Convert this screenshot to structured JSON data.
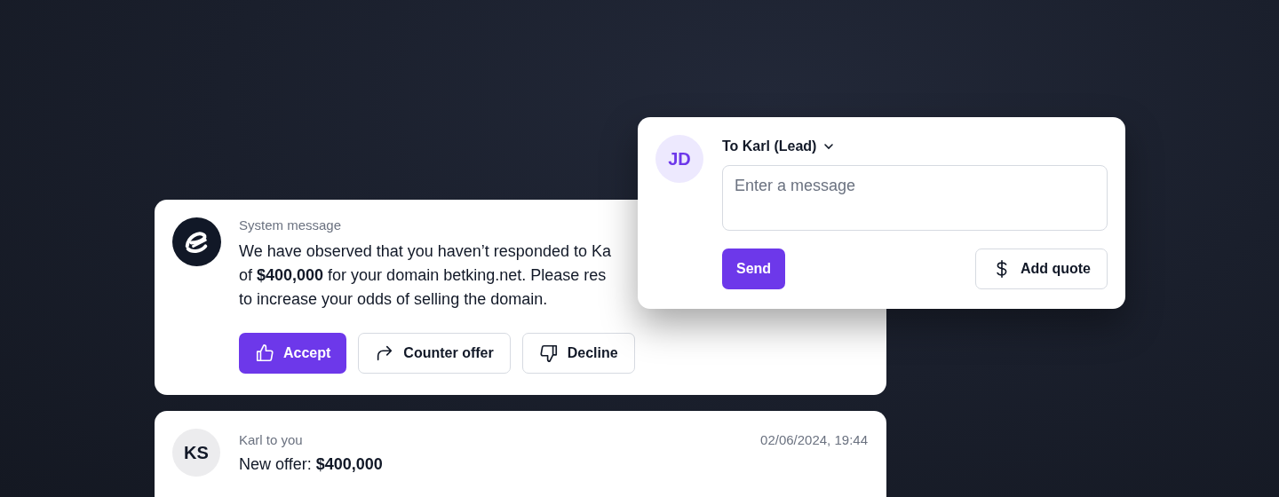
{
  "system_message": {
    "sender": "System message",
    "lines": [
      "We have observed that you haven’t responded to Ka",
      "of **$400,000** for your domain betking.net. Please res",
      "to increase your odds of selling the domain."
    ],
    "actions": [
      {
        "label": "Accept",
        "kind": "primary"
      },
      {
        "label": "Counter offer",
        "kind": "outline"
      },
      {
        "label": "Decline",
        "kind": "outline"
      }
    ]
  },
  "composer": {
    "avatar": "JD",
    "recipient": "To Karl (Lead)",
    "placeholder": "Enter a message",
    "send": "Send",
    "add_quote": "Add quote"
  },
  "message": {
    "avatar": "KS",
    "sender": "Karl to you",
    "time": "02/06/2024, 19:44",
    "text": "New offer: **$400,000**"
  }
}
